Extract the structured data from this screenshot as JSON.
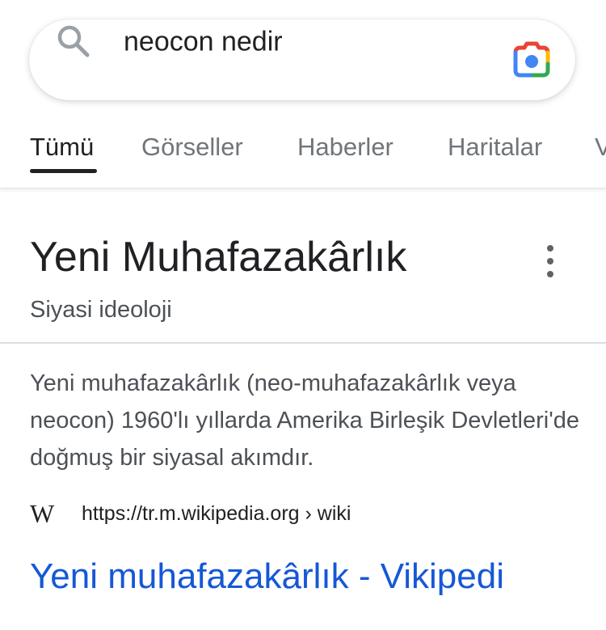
{
  "search": {
    "query": "neocon nedir",
    "icon": "search-icon",
    "lens_icon": "google-lens-icon"
  },
  "tabs": [
    {
      "label": "Tümü",
      "active": true
    },
    {
      "label": "Görseller",
      "active": false
    },
    {
      "label": "Haberler",
      "active": false
    },
    {
      "label": "Haritalar",
      "active": false
    },
    {
      "label": "V",
      "active": false
    }
  ],
  "knowledge_panel": {
    "title": "Yeni Muhafazakârlık",
    "subtitle": "Siyasi ideoloji",
    "description": "Yeni muhafazakârlık (neo-muhafazakârlık veya neocon) 1960'lı yıllarda Amerika Birleşik Devletleri'de doğmuş bir siyasal akımdır.",
    "menu_icon": "more-vert-icon"
  },
  "source": {
    "favicon": "W",
    "url": "https://tr.m.wikipedia.org › wiki",
    "link_title": "Yeni muhafazakârlık - Vikipedi"
  },
  "colors": {
    "link": "#1558d6",
    "text_primary": "#202124",
    "text_secondary": "#70757a"
  }
}
